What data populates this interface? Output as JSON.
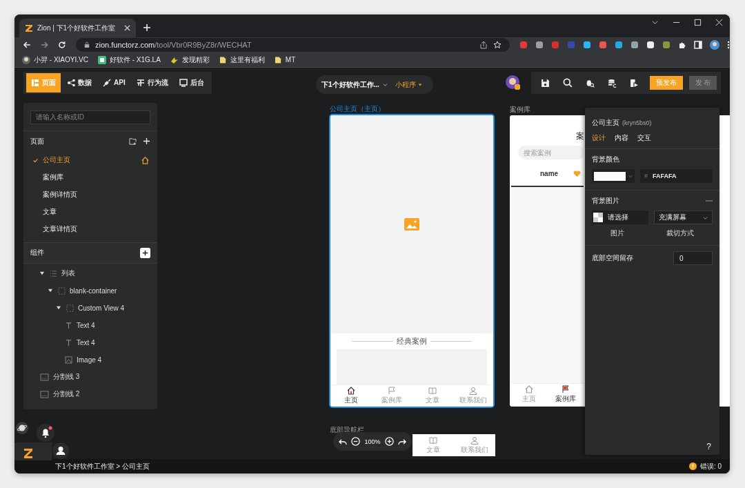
{
  "browser": {
    "tab_title": "Zion | 下1个好软件工作室",
    "url_host": "zion.functorz.com",
    "url_path": "/tool/Vbr0R9ByZ8r/WECHAT",
    "bookmarks": [
      {
        "label": "小羿 - XIAOYI.VC",
        "kind": "avatar"
      },
      {
        "label": "好软件 - X1G.LA",
        "kind": "site"
      },
      {
        "label": "发现精彩",
        "kind": "spark"
      },
      {
        "label": "这里有福利",
        "kind": "folder"
      },
      {
        "label": "MT",
        "kind": "folder"
      }
    ]
  },
  "toolbar": {
    "tabs": [
      {
        "label": "页面",
        "selected": true
      },
      {
        "label": "数据",
        "selected": false
      },
      {
        "label": "API",
        "selected": false
      },
      {
        "label": "行为流",
        "selected": false
      },
      {
        "label": "后台",
        "selected": false
      }
    ],
    "project": "下1个好软件工作...",
    "platform": "小程序",
    "prepublish": "预发布",
    "publish": "发 布",
    "publish_disabled": true
  },
  "left_panel": {
    "search": {
      "placeholder": "请输入名称或ID"
    },
    "pages_title": "页面",
    "pages": [
      {
        "label": "公司主页",
        "selected": true,
        "home": true
      },
      {
        "label": "案例库",
        "selected": false,
        "home": false
      },
      {
        "label": "案例详情页",
        "selected": false,
        "home": false
      },
      {
        "label": "文章",
        "selected": false,
        "home": false
      },
      {
        "label": "文章详情页",
        "selected": false,
        "home": false
      }
    ],
    "components_title": "组件",
    "components": [
      {
        "label": "列表",
        "kind": "list",
        "expanded": true,
        "children": [
          {
            "label": "blank-container",
            "kind": "container",
            "expanded": true,
            "children": [
              {
                "label": "Custom View 4",
                "kind": "container",
                "expanded": true,
                "children": [
                  {
                    "label": "Text 4",
                    "kind": "text"
                  },
                  {
                    "label": "Text 4",
                    "kind": "text"
                  },
                  {
                    "label": "Image 4",
                    "kind": "image"
                  }
                ]
              }
            ]
          }
        ]
      },
      {
        "label": "分割线 3",
        "kind": "divider"
      },
      {
        "label": "分割线 2",
        "kind": "divider"
      }
    ]
  },
  "canvas": {
    "home_page": {
      "label": "公司主页（主页）",
      "selected": true,
      "section_title": "经典案例",
      "tabbar": [
        {
          "label": "主页",
          "selected": true
        },
        {
          "label": "案例库",
          "selected": false
        },
        {
          "label": "文章",
          "selected": false
        },
        {
          "label": "联系我们",
          "selected": false
        }
      ]
    },
    "case_page": {
      "label": "案例库",
      "selected": false,
      "heading": "案",
      "search_placeholder": "搜索案例",
      "column": "name",
      "tabbar": [
        {
          "label": "主页",
          "selected": false
        },
        {
          "label": "案例库",
          "selected": true
        }
      ]
    },
    "bottom_nav": {
      "label": "底部导航栏",
      "items": [
        {
          "label": "文章"
        },
        {
          "label": "联系我们"
        }
      ],
      "zoom": "100%"
    }
  },
  "properties": {
    "title": "公司主页",
    "id": "(kryn5bs0)",
    "tabs": [
      {
        "label": "设计",
        "selected": true
      },
      {
        "label": "内容",
        "selected": false
      },
      {
        "label": "交互",
        "selected": false
      }
    ],
    "background_color": {
      "label": "背景颜色",
      "hash": "#",
      "value": "FAFAFA"
    },
    "background_image": {
      "label": "背景图片",
      "picker": "请选择",
      "picker_caption": "图片",
      "fit": "充满屏幕",
      "fit_caption": "裁切方式"
    },
    "bottom_space": {
      "label": "底部空间留存",
      "value": "0"
    },
    "help": "?"
  },
  "status_bar": {
    "breadcrumb": "下1个好软件工作室 > 公司主页",
    "errors": "错误: 0"
  }
}
